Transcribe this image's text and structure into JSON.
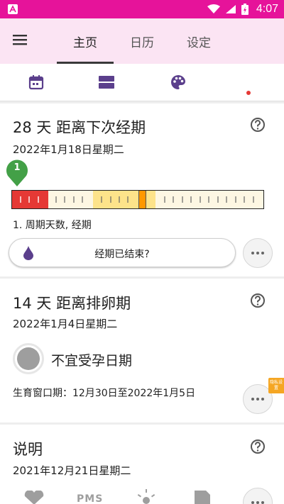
{
  "status_bar": {
    "time": "4:07",
    "app_icon": "app-badge-icon",
    "icons": [
      "wifi-icon",
      "signal-icon",
      "battery-charging-icon"
    ]
  },
  "app_bar": {
    "menu_icon": "hamburger-menu-icon",
    "tabs": [
      {
        "label": "主页",
        "active": true
      },
      {
        "label": "日历",
        "active": false
      },
      {
        "label": "设定",
        "active": false
      }
    ],
    "background": "#fbe4f3"
  },
  "toolbar": {
    "icons": [
      "calendar-icon",
      "view-rows-icon",
      "palette-icon"
    ],
    "notification_dot": true,
    "accent": "#5b3f8c"
  },
  "period_card": {
    "title": "28 天 距离下次经期",
    "date": "2022年1月18日星期二",
    "marker_number": "1",
    "caption": "1. 周期天数, 经期",
    "ended_button_label": "经期已结束?",
    "colors": {
      "period": "#e53935",
      "fertile": "#fde38a",
      "marker": "#43a047",
      "cursor": "#ff9800"
    }
  },
  "ovulation_card": {
    "title": "14 天 距离排卵期",
    "date": "2022年1月4日星期二",
    "status": "不宜受孕日期",
    "fertile_window": "生育窗口期：12月30日至2022年1月5日",
    "side_badge": "隐私设置"
  },
  "notes_card": {
    "title": "说明",
    "date": "2021年12月21日星期二",
    "pms_label": "PMS"
  }
}
